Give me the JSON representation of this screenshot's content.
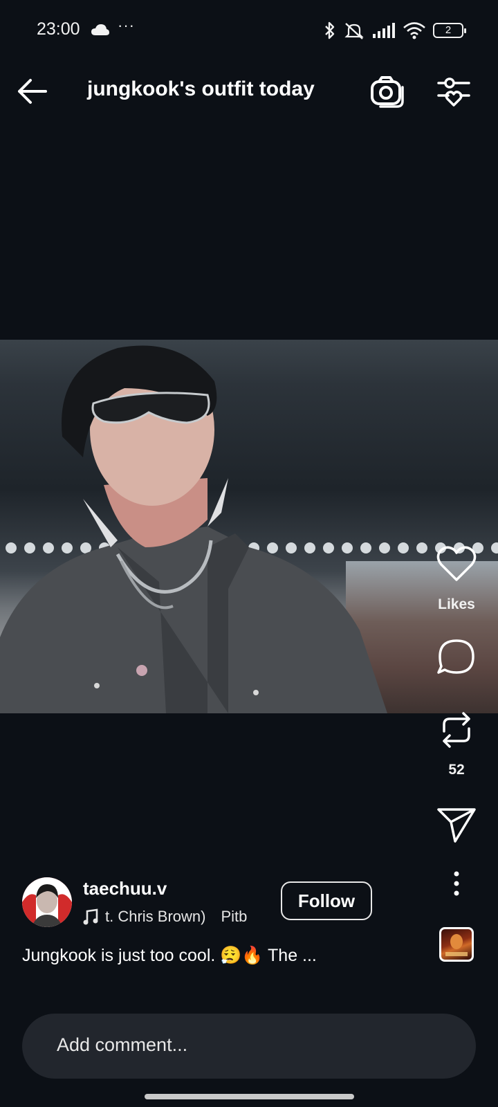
{
  "status_bar": {
    "time": "23:00",
    "overflow": "···",
    "battery": "2",
    "icons": [
      "cloud-icon",
      "bluetooth-icon",
      "mute-icon",
      "signal-icon",
      "wifi-icon",
      "battery-icon"
    ]
  },
  "header": {
    "title": "jungkook's outfit today",
    "icons": [
      "back-arrow-icon",
      "camera-icon",
      "filter-icon"
    ]
  },
  "actions": {
    "likes_label": "Likes",
    "repost_count": "52",
    "icons": [
      "heart-icon",
      "comment-icon",
      "repost-icon",
      "share-icon",
      "more-icon"
    ]
  },
  "post": {
    "username": "taechuu.v",
    "music": "t. Chris Brown)",
    "music_next": "Pitb",
    "follow_label": "Follow",
    "caption": "Jungkook is just too cool. 😮‍💨🔥 The ..."
  },
  "comment": {
    "placeholder": "Add comment..."
  },
  "colors": {
    "background": "#0c1016",
    "comment_bar": "#22262d",
    "text": "#ffffff"
  }
}
